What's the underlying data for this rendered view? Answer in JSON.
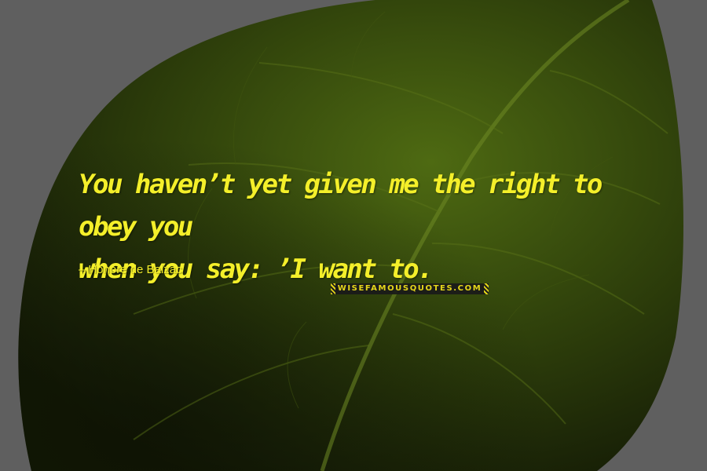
{
  "quote": {
    "line1": "You haven’t yet given me the right to obey you",
    "line2": "when you say: ’I want to."
  },
  "author": {
    "dash_icon": "dash-icon",
    "name": "Honore de Balzac"
  },
  "watermark": {
    "text": "WISEFAMOUSQUOTES.COM"
  },
  "colors": {
    "text": "#f4ef2a",
    "backdrop": "#5f5f5f",
    "leaf_dark": "#1a2208",
    "leaf_light": "#4e6a12"
  }
}
